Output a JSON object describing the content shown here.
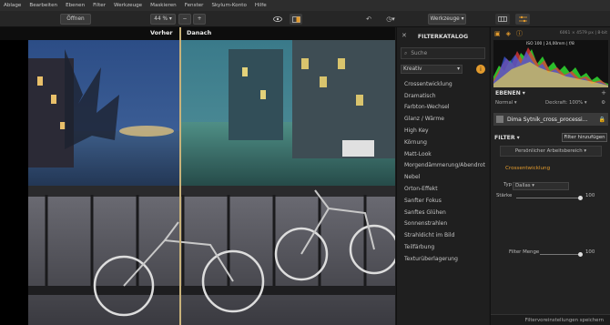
{
  "menu": [
    "Ablage",
    "Bearbeiten",
    "Ebenen",
    "Filter",
    "Werkzeuge",
    "Maskieren",
    "Fenster",
    "Skylum-Konto",
    "Hilfe"
  ],
  "toolbar": {
    "open_label": "Öffnen",
    "zoom": "44 %",
    "zoom_minus": "−",
    "zoom_plus": "+",
    "tools_label": "Werkzeuge"
  },
  "compare": {
    "before": "Vorher",
    "after": "Danach"
  },
  "filter_catalog": {
    "title": "FILTERKATALOG",
    "search_placeholder": "Suche",
    "category": "Kreativ",
    "items": [
      "Crossentwicklung",
      "Dramatisch",
      "Farbton-Wechsel",
      "Glanz / Wärme",
      "High Key",
      "Körnung",
      "Matt-Look",
      "Morgendämmerung/Abendrot",
      "Nebel",
      "Orton-Effekt",
      "Sanfter Fokus",
      "Sanftes Glühen",
      "Sonnenstrahlen",
      "Strahldicht im Bild",
      "Teilfärbung",
      "Texturüberlagerung"
    ]
  },
  "info": {
    "dimensions": "6061 × 4579 px",
    "bitdepth": "8-bit",
    "exif": "ISO 100 | 24,00mm | f/8"
  },
  "layers": {
    "title": "EBENEN",
    "blend": "Normal",
    "opacity": "Deckraft: 100%",
    "layer_name": "Dima Sytnik_cross_processi..."
  },
  "filter": {
    "title": "FILTER",
    "add_label": "Filter hinzufügen",
    "personal_label": "Persönlicher Arbeitsbereich",
    "active_filter": "Crossentwicklung",
    "type_label": "Typ",
    "type_value": "Dallas",
    "strength_label": "Stärke",
    "strength_value": "100",
    "amount_label": "Filter Menge",
    "amount_value": "100"
  },
  "save_label": "Filtervoreinstellungen speichern",
  "colors": {
    "accent": "#e39b2d"
  }
}
